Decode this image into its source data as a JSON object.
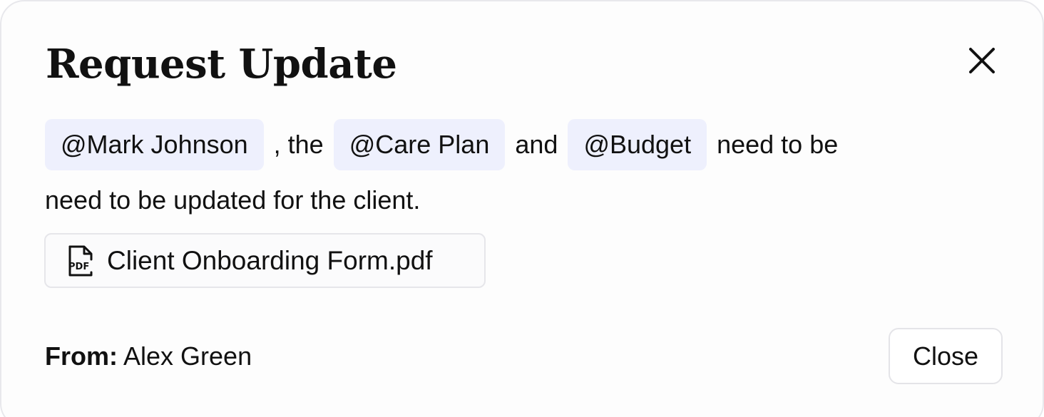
{
  "dialog": {
    "title": "Request Update",
    "close_icon": "close-icon"
  },
  "message": {
    "mention_1": "@Mark Johnson",
    "connector_1": ", the",
    "mention_2": "@Care Plan",
    "connector_2": "and",
    "mention_3": "@Budget",
    "connector_3": "need to be",
    "line_2": "need to be updated for the client."
  },
  "attachment": {
    "icon": "pdf-file-icon",
    "file_name": "Client Onboarding Form.pdf"
  },
  "footer": {
    "from_label": "From:",
    "from_value": "Alex Green",
    "close_label": "Close"
  },
  "colors": {
    "mention_chip_bg": "#eef0fd",
    "text": "#111111",
    "border": "#e6e6ea"
  }
}
